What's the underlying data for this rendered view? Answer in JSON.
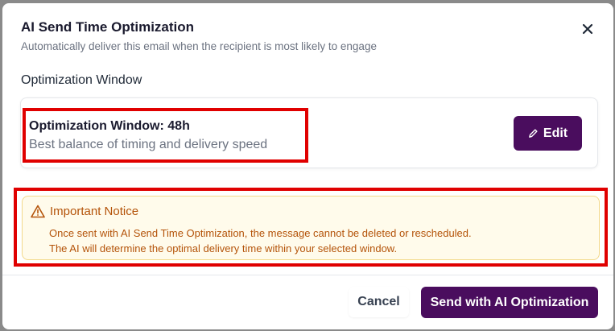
{
  "modal": {
    "title": "AI Send Time Optimization",
    "subtitle": "Automatically deliver this email when the recipient is most likely to engage",
    "close_icon": "close-icon"
  },
  "optimization": {
    "section_label": "Optimization Window",
    "window_title": "Optimization Window: 48h",
    "window_description": "Best balance of timing and delivery speed",
    "edit_label": "Edit",
    "edit_icon": "pencil-icon"
  },
  "notice": {
    "icon": "warning-triangle-icon",
    "title": "Important Notice",
    "line1": "Once sent with AI Send Time Optimization, the message cannot be deleted or rescheduled.",
    "line2": "The AI will determine the optimal delivery time within your selected window."
  },
  "footer": {
    "cancel_label": "Cancel",
    "send_label": "Send with AI Optimization"
  },
  "colors": {
    "primary": "#4a0d5e",
    "warning_text": "#b45309",
    "warning_bg": "#fffbeb",
    "highlight": "#e00000"
  }
}
